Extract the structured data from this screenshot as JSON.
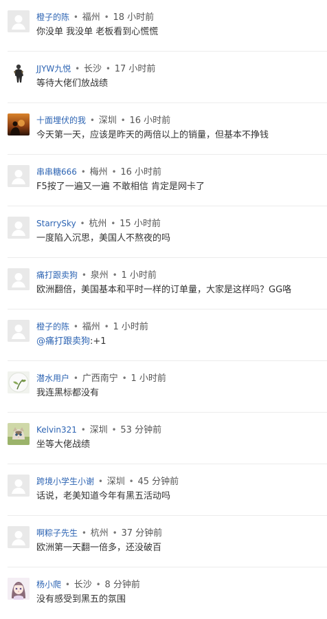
{
  "separator": "•",
  "comments": [
    {
      "username": "橙子的陈",
      "location": "福州",
      "time": "18 小时前",
      "content": "你没单 我没单 老板看到心慌慌",
      "avatar_icon": "default-avatar-icon"
    },
    {
      "username": "JJYW九悦",
      "location": "长沙",
      "time": "17 小时前",
      "content": "等待大佬们放战绩",
      "avatar_icon": "figure-avatar-icon"
    },
    {
      "username": "十面埋伏的我",
      "location": "深圳",
      "time": "16 小时前",
      "content": "今天第一天，应该是昨天的两倍以上的销量，但基本不挣钱",
      "avatar_icon": "sunset-avatar-icon"
    },
    {
      "username": "串串糖666",
      "location": "梅州",
      "time": "16 小时前",
      "content": "F5按了一遍又一遍 不敢相信 肯定是网卡了",
      "avatar_icon": "default-avatar-icon"
    },
    {
      "username": "StarrySky",
      "location": "杭州",
      "time": "15 小时前",
      "content": "一度陷入沉思，美国人不熬夜的吗",
      "avatar_icon": "default-avatar-icon"
    },
    {
      "username": "痛打跟卖狗",
      "location": "泉州",
      "time": "1 小时前",
      "content": "欧洲翻倍，美国基本和平时一样的订单量，大家是这样吗？GG咯",
      "avatar_icon": "default-avatar-icon"
    },
    {
      "username": "橙子的陈",
      "location": "福州",
      "time": "1 小时前",
      "mention": "@痛打跟卖狗",
      "content": ":+1",
      "avatar_icon": "default-avatar-icon"
    },
    {
      "username": "潜水用户",
      "location": "广西南宁",
      "time": "1 小时前",
      "content": "我连黑标都没有",
      "avatar_icon": "plant-avatar-icon"
    },
    {
      "username": "Kelvin321",
      "location": "深圳",
      "time": "53 分钟前",
      "content": "坐等大佬战绩",
      "avatar_icon": "cat-avatar-icon"
    },
    {
      "username": "跨境小学生小谢",
      "location": "深圳",
      "time": "45 分钟前",
      "content": "话说，老美知道今年有黑五活动吗",
      "avatar_icon": "default-avatar-icon"
    },
    {
      "username": "啊粽子先生",
      "location": "杭州",
      "time": "37 分钟前",
      "content": "欧洲第一天翻一倍多，还没破百",
      "avatar_icon": "default-avatar-icon"
    },
    {
      "username": "杨小爬",
      "location": "长沙",
      "time": "8 分钟前",
      "content": "没有感受到黑五的氛围",
      "avatar_icon": "anime-girl-avatar-icon"
    }
  ]
}
